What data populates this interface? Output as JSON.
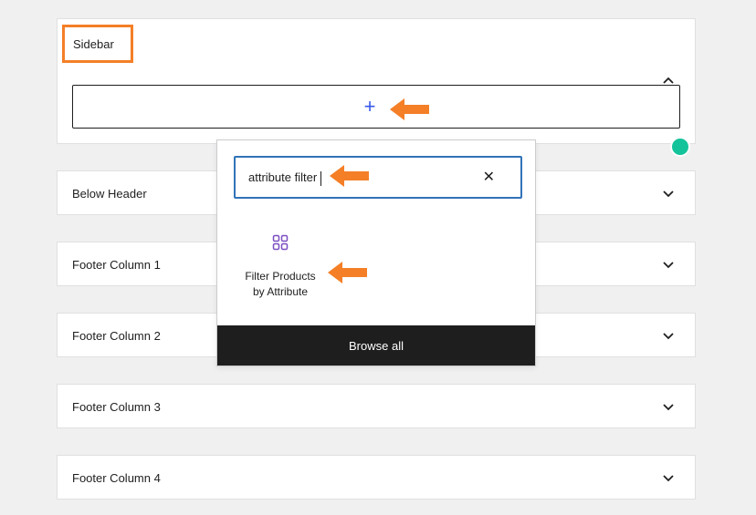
{
  "panels": {
    "sidebar": {
      "title": "Sidebar"
    },
    "below_header": {
      "title": "Below Header"
    },
    "footer_1": {
      "title": "Footer Column 1"
    },
    "footer_2": {
      "title": "Footer Column 2"
    },
    "footer_3": {
      "title": "Footer Column 3"
    },
    "footer_4": {
      "title": "Footer Column 4"
    }
  },
  "appender": {
    "icon": "plus-icon",
    "symbol": "+"
  },
  "inserter": {
    "search_value": "attribute filter",
    "clear_icon": "close-icon",
    "clear_symbol": "✕",
    "results": [
      {
        "icon": "grid-icon",
        "label_line1": "Filter Products",
        "label_line2": "by Attribute"
      }
    ],
    "browse_all_label": "Browse all"
  },
  "colors": {
    "highlight": "#f47f27",
    "accent_blue": "#3173b7",
    "block_icon": "#7b4fc1",
    "browse_bg": "#1e1e1e",
    "help_green": "#15c39a"
  },
  "annotations": [
    "arrow-icon",
    "arrow-icon",
    "arrow-icon",
    "arrow-icon"
  ]
}
